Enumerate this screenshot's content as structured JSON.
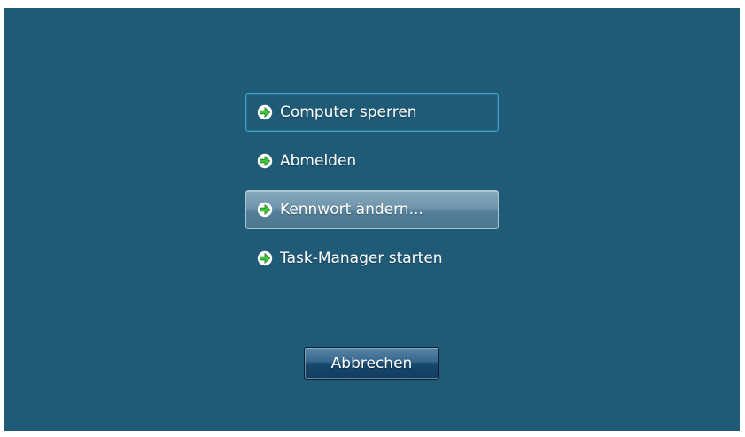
{
  "menu": {
    "items": [
      {
        "label": "Computer sperren",
        "icon": "green-arrow-icon",
        "state": "focused"
      },
      {
        "label": "Abmelden",
        "icon": "green-arrow-icon",
        "state": "normal"
      },
      {
        "label": "Kennwort ändern...",
        "icon": "green-arrow-icon",
        "state": "hover"
      },
      {
        "label": "Task-Manager starten",
        "icon": "green-arrow-icon",
        "state": "normal"
      }
    ]
  },
  "cancel_button": {
    "label": "Abbrechen"
  },
  "colors": {
    "background": "#1f5a76",
    "arrow_green": "#3fc93a",
    "focus_border": "#3ea6cf"
  }
}
